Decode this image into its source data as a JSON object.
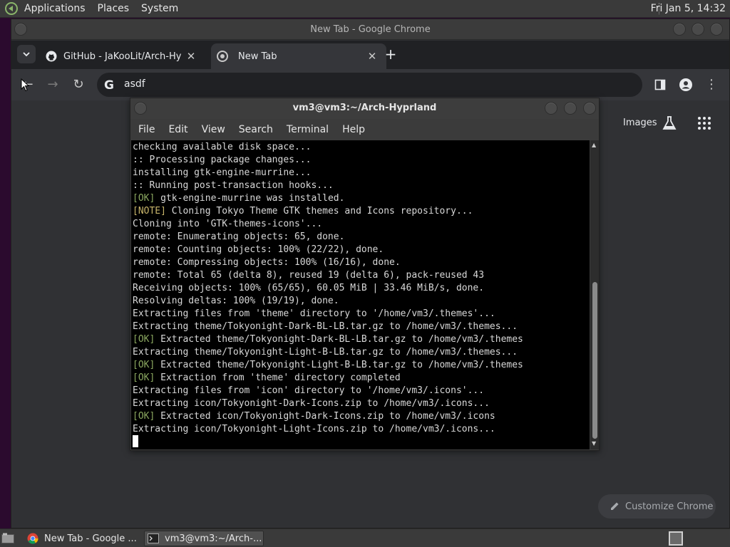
{
  "top_panel": {
    "menus": [
      "Applications",
      "Places",
      "System"
    ],
    "clock": "Fri Jan  5, 14:32"
  },
  "chrome": {
    "title": "New Tab - Google Chrome",
    "tabs": [
      {
        "label": "GitHub - JaKooLit/Arch-Hyprl",
        "icon": "github-icon",
        "active": false
      },
      {
        "label": "New Tab",
        "icon": "chrome-icon",
        "active": true
      }
    ],
    "omnibox_text": "asdf",
    "ntp": {
      "images_label": "Images",
      "customize_label": "Customize Chrome"
    }
  },
  "terminal": {
    "title": "vm3@vm3:~/Arch-Hyprland",
    "menus": [
      "File",
      "Edit",
      "View",
      "Search",
      "Terminal",
      "Help"
    ],
    "lines": [
      {
        "tag": "",
        "text": "checking available disk space..."
      },
      {
        "tag": "",
        "text": ":: Processing package changes..."
      },
      {
        "tag": "",
        "text": "installing gtk-engine-murrine..."
      },
      {
        "tag": "",
        "text": ":: Running post-transaction hooks..."
      },
      {
        "tag": "[OK]",
        "text": " gtk-engine-murrine was installed."
      },
      {
        "tag": "[NOTE]",
        "text": " Cloning Tokyo Theme GTK themes and Icons repository..."
      },
      {
        "tag": "",
        "text": "Cloning into 'GTK-themes-icons'..."
      },
      {
        "tag": "",
        "text": "remote: Enumerating objects: 65, done."
      },
      {
        "tag": "",
        "text": "remote: Counting objects: 100% (22/22), done."
      },
      {
        "tag": "",
        "text": "remote: Compressing objects: 100% (16/16), done."
      },
      {
        "tag": "",
        "text": "remote: Total 65 (delta 8), reused 19 (delta 6), pack-reused 43"
      },
      {
        "tag": "",
        "text": "Receiving objects: 100% (65/65), 60.05 MiB | 33.46 MiB/s, done."
      },
      {
        "tag": "",
        "text": "Resolving deltas: 100% (19/19), done."
      },
      {
        "tag": "",
        "text": "Extracting files from 'theme' directory to '/home/vm3/.themes'..."
      },
      {
        "tag": "",
        "text": "Extracting theme/Tokyonight-Dark-BL-LB.tar.gz to /home/vm3/.themes..."
      },
      {
        "tag": "[OK]",
        "text": " Extracted theme/Tokyonight-Dark-BL-LB.tar.gz to /home/vm3/.themes"
      },
      {
        "tag": "",
        "text": "Extracting theme/Tokyonight-Light-B-LB.tar.gz to /home/vm3/.themes..."
      },
      {
        "tag": "[OK]",
        "text": " Extracted theme/Tokyonight-Light-B-LB.tar.gz to /home/vm3/.themes"
      },
      {
        "tag": "[OK]",
        "text": " Extraction from 'theme' directory completed"
      },
      {
        "tag": "",
        "text": "Extracting files from 'icon' directory to '/home/vm3/.icons'..."
      },
      {
        "tag": "",
        "text": "Extracting icon/Tokyonight-Dark-Icons.zip to /home/vm3/.icons..."
      },
      {
        "tag": "[OK]",
        "text": " Extracted icon/Tokyonight-Dark-Icons.zip to /home/vm3/.icons"
      },
      {
        "tag": "",
        "text": "Extracting icon/Tokyonight-Light-Icons.zip to /home/vm3/.icons..."
      }
    ]
  },
  "taskbar": {
    "tasks": [
      {
        "label": "New Tab - Google ...",
        "icon": "chrome-icon",
        "active": false
      },
      {
        "label": "vm3@vm3:~/Arch-...",
        "icon": "terminal-icon",
        "active": true
      }
    ]
  },
  "colors": {
    "ok_tag": "#8ba860",
    "note_tag": "#c8b56a",
    "terminal_bg": "#000000",
    "chrome_bg": "#303134"
  }
}
